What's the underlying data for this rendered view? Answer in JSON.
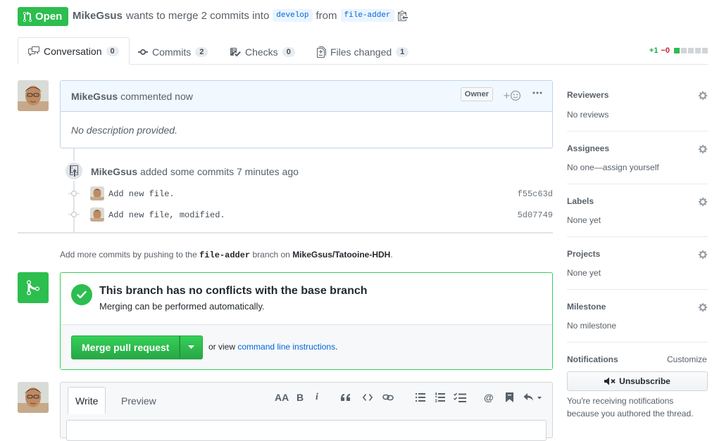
{
  "header": {
    "state": "Open",
    "author": "MikeGsus",
    "merge_text": "wants to merge 2 commits into",
    "base_branch": "develop",
    "from_text": "from",
    "head_branch": "file-adder"
  },
  "tabs": [
    {
      "label": "Conversation",
      "count": "0"
    },
    {
      "label": "Commits",
      "count": "2"
    },
    {
      "label": "Checks",
      "count": "0"
    },
    {
      "label": "Files changed",
      "count": "1"
    }
  ],
  "diffstat": {
    "additions": "+1",
    "deletions": "−0"
  },
  "comment": {
    "author": "MikeGsus",
    "action": "commented now",
    "badge": "Owner",
    "body": "No description provided."
  },
  "commits_event": {
    "author": "MikeGsus",
    "action": "added some commits 7 minutes ago",
    "commits": [
      {
        "message": "Add new file.",
        "sha": "f55c63d"
      },
      {
        "message": "Add new file, modified.",
        "sha": "5d07749"
      }
    ]
  },
  "push_hint": {
    "prefix": "Add more commits by pushing to the",
    "branch": "file-adder",
    "middle": "branch on",
    "repo": "MikeGsus/Tatooine-HDH",
    "suffix": "."
  },
  "merge": {
    "title": "This branch has no conflicts with the base branch",
    "subtitle": "Merging can be performed automatically.",
    "button": "Merge pull request",
    "or_text": "or view",
    "link": "command line instructions",
    "link_suffix": "."
  },
  "sidebar": {
    "reviewers": {
      "title": "Reviewers",
      "value": "No reviews"
    },
    "assignees": {
      "title": "Assignees",
      "value": "No one—assign yourself"
    },
    "labels": {
      "title": "Labels",
      "value": "None yet"
    },
    "projects": {
      "title": "Projects",
      "value": "None yet"
    },
    "milestone": {
      "title": "Milestone",
      "value": "No milestone"
    },
    "notifications": {
      "title": "Notifications",
      "customize": "Customize",
      "button": "Unsubscribe",
      "note_line1": "You're receiving notifications",
      "note_line2": "because you authored the thread."
    }
  },
  "editor": {
    "write_tab": "Write",
    "preview_tab": "Preview",
    "toolbar": {
      "heading": "AA",
      "bold": "B",
      "italic": "i",
      "mention": "@"
    }
  },
  "colors": {
    "green": "#2cbe4e",
    "link": "#0366d6",
    "red": "#cb2431"
  }
}
